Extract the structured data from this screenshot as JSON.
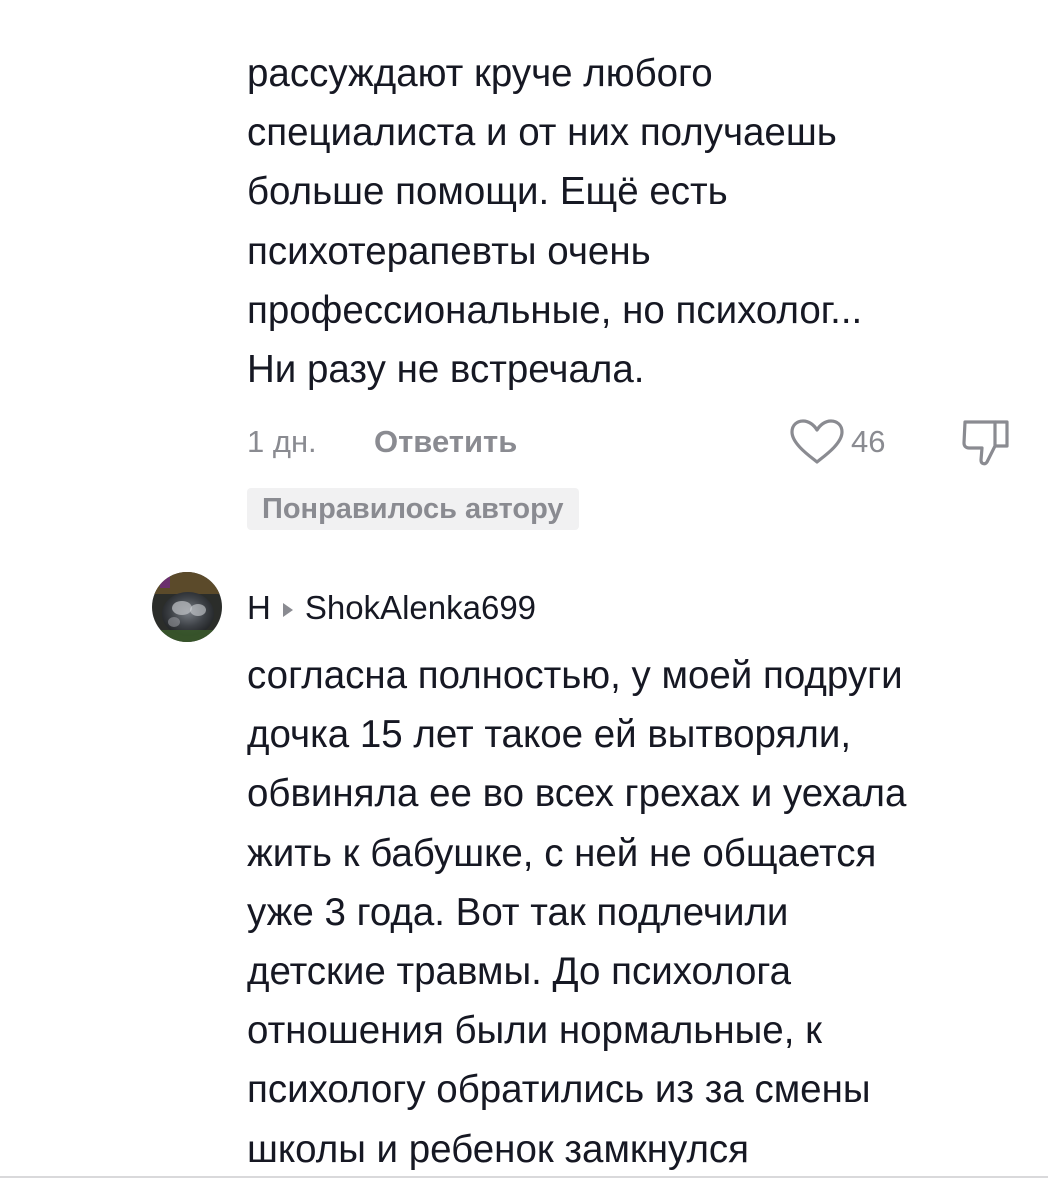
{
  "comment1": {
    "text_lines": [
      "рассуждают круче любого",
      "специалиста и от них получаешь",
      "больше помощи. Ещё есть",
      "психотерапевты очень",
      "профессиональные, но психолог...",
      "Ни разу не встречала."
    ],
    "time": "1 дн.",
    "reply_label": "Ответить",
    "like_count": "46",
    "like_icon": "heart-outline-icon",
    "dislike_icon": "thumbs-down-icon",
    "liked_by_author": "Понравилось автору"
  },
  "comment2": {
    "author": "Н",
    "reply_to": "ShokAlenka699",
    "avatar_icon": "user-avatar",
    "text_lines": [
      "согласна полностью, у моей подруги",
      "дочка 15 лет такое ей вытворяли,",
      "обвиняла ее во всех грехах и уехала",
      "жить к бабушке, с ней не общается",
      "уже 3 года. Вот так подлечили",
      "детские травмы. До психолога",
      "отношения были нормальные, к",
      "психологу обратились из за смены",
      "школы и ребенок замкнулся"
    ]
  },
  "colors": {
    "text": "#161823",
    "secondary": "#8a8b91",
    "badge_bg": "#f1f1f2"
  }
}
